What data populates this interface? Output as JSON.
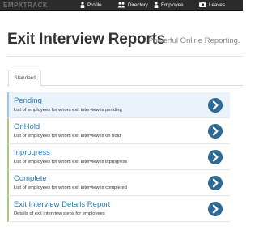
{
  "nav": {
    "profile": "Profile",
    "directory": "Directory",
    "employee": "Employee",
    "leaves": "Leaves"
  },
  "header": {
    "title": "Exit Interview Reports",
    "subtitle": "Powerful Online Reporting."
  },
  "tabs": [
    {
      "label": "Standard",
      "selected": true
    }
  ],
  "reports": [
    {
      "title": "Pending",
      "description": "List of employees for whom exit interview is pending",
      "highlighted": true
    },
    {
      "title": "OnHold",
      "description": "List of employees for whom exit interview is on hold"
    },
    {
      "title": "Inprogress",
      "description": "List of employees for whom exit interview is inprogress"
    },
    {
      "title": "Complete",
      "description": "List of employees for whom exit interview is completed"
    },
    {
      "title": "Exit Interview Details Report",
      "description": "Details of exit interview steps for employees"
    }
  ],
  "colors": {
    "navbar": "#2b2b2b",
    "link": "#2a7ab5",
    "accent_bar": "#a9cb74",
    "highlight_bg": "#eaf3fb",
    "go_button": "#2d6a96"
  },
  "icons": {
    "profile": "person-icon",
    "directory": "people-icon",
    "employee": "person-icon",
    "leaves": "camera-icon",
    "go": "chevron-right-circle-icon"
  }
}
